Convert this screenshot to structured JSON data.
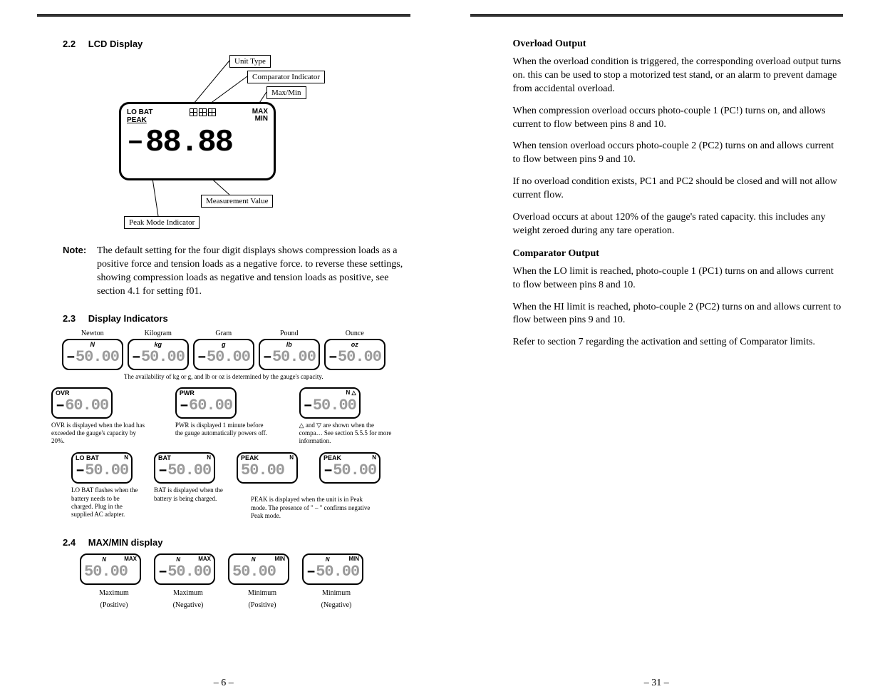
{
  "left": {
    "s22": {
      "num": "2.2",
      "title": "LCD Display"
    },
    "fig22": {
      "labels": {
        "unit_type": "Unit Type",
        "comparator": "Comparator Indicator",
        "maxmin": "Max/Min",
        "measurement": "Measurement Value",
        "peak": "Peak Mode Indicator"
      },
      "lcd": {
        "lo_bat": "LO BAT",
        "peak": "PEAK",
        "max": "MAX",
        "min": "MIN",
        "digits": "88.88"
      }
    },
    "note_label": "Note:",
    "note_text": "The default setting for the four digit displays shows compression loads as a positive force and tension loads as a negative force. to reverse these settings, showing compression loads as negative and tension loads as positive, see section 4.1 for setting f01.",
    "s23": {
      "num": "2.3",
      "title": "Display Indicators"
    },
    "units_row": [
      {
        "hdr": "Newton",
        "unit": "N",
        "val": "50.00",
        "neg": true
      },
      {
        "hdr": "Kilogram",
        "unit": "kg",
        "val": "50.00",
        "neg": true
      },
      {
        "hdr": "Gram",
        "unit": "g",
        "val": "50.00",
        "neg": true
      },
      {
        "hdr": "Pound",
        "unit": "lb",
        "val": "50.00",
        "neg": true
      },
      {
        "hdr": "Ounce",
        "unit": "oz",
        "val": "50.00",
        "neg": true
      }
    ],
    "units_note": "The availability of kg or g, and lb or oz is determined by the gauge's capacity.",
    "row2": [
      {
        "tl": "OVR",
        "val": "60.00",
        "neg": true,
        "desc": "OVR is displayed when the load has exceeded the gauge's capacity by 20%."
      },
      {
        "tl": "PWR",
        "val": "60.00",
        "neg": true,
        "desc": "PWR is displayed 1 minute before the gauge automatically powers off."
      },
      {
        "tl": "",
        "tr": "N △",
        "val": "50.00",
        "neg": true,
        "desc": "△ and ▽ are shown when the compa… See section 5.5.5 for more information."
      }
    ],
    "row3": [
      {
        "tl": "LO BAT",
        "tr": "N",
        "val": "50.00",
        "neg": true,
        "desc": "LO BAT flashes when the battery needs to be charged. Plug in the supplied AC adapter."
      },
      {
        "tl": "BAT",
        "tr": "N",
        "val": "50.00",
        "neg": true,
        "desc": "BAT is displayed when the battery is being charged."
      },
      {
        "tl": "PEAK",
        "tr": "N",
        "val": "50.00",
        "neg": false,
        "desc": ""
      },
      {
        "tl": "PEAK",
        "tr": "N",
        "val": "50.00",
        "neg": true,
        "boldminus": true,
        "desc": ""
      }
    ],
    "row3_peak_desc": "PEAK is displayed when the unit is in Peak mode. The presence of \" – \" confirms negative Peak mode.",
    "s24": {
      "num": "2.4",
      "title": "MAX/MIN display"
    },
    "row4": [
      {
        "tr_unit": "N",
        "tr": "MAX",
        "val": "50.00",
        "neg": false,
        "l1": "Maximum",
        "l2": "(Positive)"
      },
      {
        "tr_unit": "N",
        "tr": "MAX",
        "val": "50.00",
        "neg": true,
        "l1": "Maximum",
        "l2": "(Negative)"
      },
      {
        "tr_unit": "N",
        "tr": "MIN",
        "val": "50.00",
        "neg": false,
        "l1": "Minimum",
        "l2": "(Positive)"
      },
      {
        "tr_unit": "N",
        "tr": "MIN",
        "val": "50.00",
        "neg": true,
        "l1": "Minimum",
        "l2": "(Negative)"
      }
    ],
    "pagenum": "– 6 –"
  },
  "right": {
    "h1": "Overload Output",
    "p1": "When the overload condition is triggered, the corresponding overload output turns on. this can be used to stop a motorized test stand, or an alarm to prevent damage from accidental overload.",
    "p2": "When compression overload occurs photo-couple 1 (PC!) turns on, and allows current to flow between pins 8 and 10.",
    "p3": "When tension overload occurs photo-couple 2 (PC2) turns on and allows current to flow between pins 9 and 10.",
    "p4": "If no overload condition exists, PC1 and PC2 should be closed and will not allow current flow.",
    "p5": "Overload occurs at about 120% of the gauge's rated capacity. this includes any weight zeroed during any tare operation.",
    "h2": "Comparator Output",
    "p6": "When the LO limit is reached, photo-couple 1 (PC1) turns on and allows current to flow between pins 8 and 10.",
    "p7": "When the HI limit is reached, photo-couple 2 (PC2) turns on and allows current to flow between pins 9 and 10.",
    "p8": "Refer to section 7 regarding the activation and setting of Comparator limits.",
    "pagenum": "– 31 –"
  }
}
